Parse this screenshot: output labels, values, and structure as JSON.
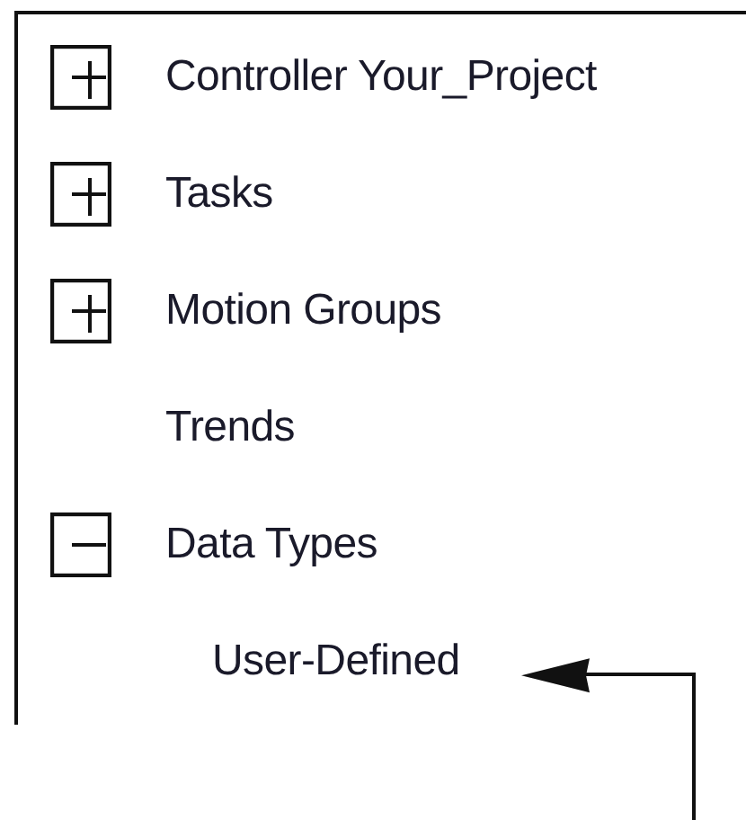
{
  "tree": [
    {
      "label": "Controller Your_Project",
      "kind": "branch",
      "expanded": false
    },
    {
      "label": "Tasks",
      "kind": "branch",
      "expanded": false
    },
    {
      "label": "Motion Groups",
      "kind": "branch",
      "expanded": false
    },
    {
      "label": "Trends",
      "kind": "leaf"
    },
    {
      "label": "Data Types",
      "kind": "branch",
      "expanded": true,
      "children": [
        {
          "label": "User-Defined",
          "kind": "leaf"
        }
      ]
    }
  ]
}
